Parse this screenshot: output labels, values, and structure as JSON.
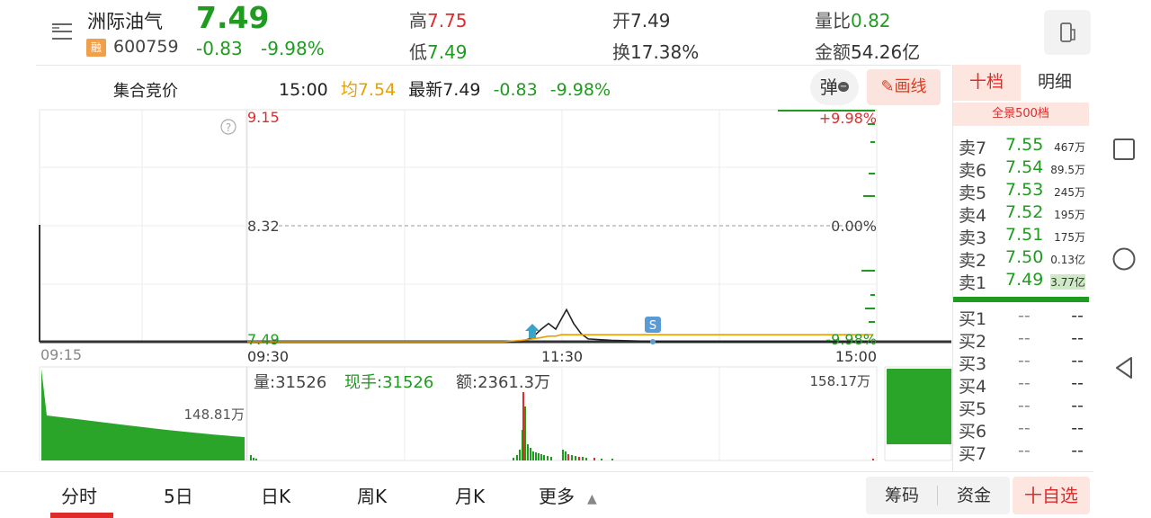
{
  "header": {
    "stock_name": "洲际油气",
    "rong_badge": "融",
    "stock_code": "600759",
    "price": "7.49",
    "change": "-0.83",
    "change_pct": "-9.98%",
    "high_label": "高",
    "high_val": "7.75",
    "low_label": "低",
    "low_val": "7.49",
    "open_label": "开",
    "open_val": "7.49",
    "turnover_label": "换",
    "turnover_val": "17.38%",
    "vol_ratio_label": "量比",
    "vol_ratio_val": "0.82",
    "amount_label": "金额",
    "amount_val": "54.26亿"
  },
  "row2": {
    "auction_label": "集合竞价",
    "time": "15:00",
    "avg_label": "均",
    "avg_val": "7.54",
    "latest_label": "最新",
    "latest_val": "7.49",
    "change": "-0.83",
    "change_pct": "-9.98%",
    "pop_button": "弹",
    "draw_button": "画线"
  },
  "chart": {
    "price_top": "9.15",
    "price_mid": "8.32",
    "price_bottom": "7.49",
    "pct_top": "+9.98%",
    "pct_mid": "0.00%",
    "pct_bottom": "-9.98%",
    "time_auction": "09:15",
    "time_open": "09:30",
    "time_mid": "11:30",
    "time_close": "15:00",
    "help_glyph": "?",
    "marker_s": "S",
    "volume_label_left": "148.81万",
    "volume_max": "158.17万",
    "vol_info": "量:31526",
    "now_hand": "现手:31526",
    "amount_info": "额:2361.3万"
  },
  "chart_data": {
    "type": "line",
    "title": "",
    "series": [
      {
        "values": [
          7.49,
          7.49,
          7.49,
          7.49,
          7.52,
          7.58,
          7.62,
          7.58,
          7.65,
          7.72,
          7.62,
          7.55,
          7.51,
          7.5,
          7.49,
          7.49
        ]
      },
      {
        "values": [
          7.49,
          7.49,
          7.49,
          7.5,
          7.51,
          7.52,
          7.53,
          7.53,
          7.54,
          7.54,
          7.54,
          7.54,
          7.54,
          7.54,
          7.54,
          7.54
        ]
      }
    ],
    "ylim": [
      7.49,
      9.15
    ]
  },
  "book": {
    "tab_ten": "十档",
    "tab_detail": "明细",
    "full_500": "全景500档",
    "asks": [
      {
        "label": "卖7",
        "price": "7.55",
        "vol": "467万"
      },
      {
        "label": "卖6",
        "price": "7.54",
        "vol": "89.5万"
      },
      {
        "label": "卖5",
        "price": "7.53",
        "vol": "245万"
      },
      {
        "label": "卖4",
        "price": "7.52",
        "vol": "195万"
      },
      {
        "label": "卖3",
        "price": "7.51",
        "vol": "175万"
      },
      {
        "label": "卖2",
        "price": "7.50",
        "vol": "0.13亿"
      },
      {
        "label": "卖1",
        "price": "7.49",
        "vol": "3.77亿"
      }
    ],
    "bids": [
      {
        "label": "买1",
        "price": "--",
        "vol": "--"
      },
      {
        "label": "买2",
        "price": "--",
        "vol": "--"
      },
      {
        "label": "买3",
        "price": "--",
        "vol": "--"
      },
      {
        "label": "买4",
        "price": "--",
        "vol": "--"
      },
      {
        "label": "买5",
        "price": "--",
        "vol": "--"
      },
      {
        "label": "买6",
        "price": "--",
        "vol": "--"
      },
      {
        "label": "买7",
        "price": "--",
        "vol": "--"
      }
    ]
  },
  "bottom": {
    "tab_intraday": "分时",
    "tab_5day": "5日",
    "tab_day": "日K",
    "tab_week": "周K",
    "tab_month": "月K",
    "tab_more": "更多",
    "btn_chips": "筹码",
    "btn_funds": "资金",
    "btn_add": "十自选"
  },
  "colors": {
    "down": "#1f9c1f",
    "up": "#e02b2b",
    "avg": "#e6a100"
  }
}
